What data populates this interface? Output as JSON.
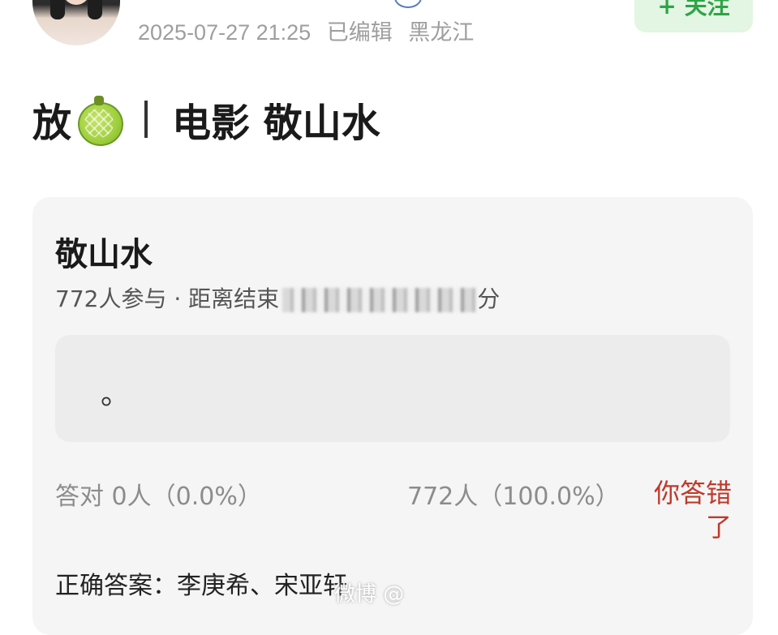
{
  "post": {
    "timestamp": "2025-07-27 21:25",
    "edited": "已编辑",
    "location": "黑龙江",
    "follow_label": "+ 关注",
    "headline_prefix": "放",
    "headline_title": "电影 敬山水"
  },
  "poll": {
    "title": "敬山水",
    "participants": "772人参与",
    "separator": "·",
    "ends_label": "距离结束",
    "ends_suffix": "分",
    "option_text": "。",
    "correct_count": "答对  0人（0.0%）",
    "other_count": "772人（100.0%）",
    "result": "你答错了",
    "answer": "正确答案：李庚希、宋亚轩"
  },
  "watermark": "微博 @"
}
